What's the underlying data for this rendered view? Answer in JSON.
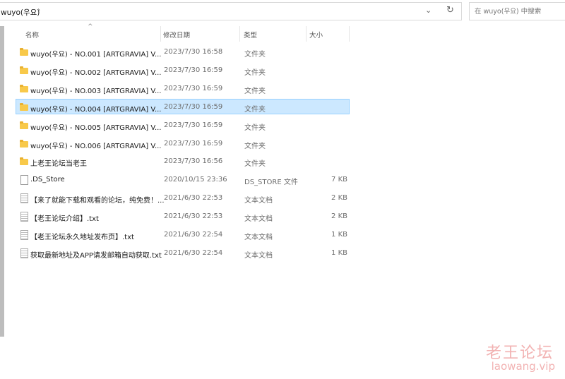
{
  "address": {
    "path": "wuyo(우요)",
    "separator": "›",
    "dropdown_icon": "chevron-down",
    "refresh_icon": "refresh"
  },
  "search": {
    "placeholder": "在 wuyo(우요) 中搜索"
  },
  "columns": {
    "name": "名称",
    "date": "修改日期",
    "type": "类型",
    "size": "大小"
  },
  "rows": [
    {
      "name": "wuyo(우요) - NO.001 [ARTGRAVIA] V...",
      "date": "2023/7/30 16:58",
      "type": "文件夹",
      "size": "",
      "icon": "folder"
    },
    {
      "name": "wuyo(우요) - NO.002 [ARTGRAVIA] V...",
      "date": "2023/7/30 16:59",
      "type": "文件夹",
      "size": "",
      "icon": "folder"
    },
    {
      "name": "wuyo(우요) - NO.003 [ARTGRAVIA] V...",
      "date": "2023/7/30 16:59",
      "type": "文件夹",
      "size": "",
      "icon": "folder"
    },
    {
      "name": "wuyo(우요) - NO.004 [ARTGRAVIA] V...",
      "date": "2023/7/30 16:59",
      "type": "文件夹",
      "size": "",
      "icon": "folder",
      "selected": true
    },
    {
      "name": "wuyo(우요) - NO.005 [ARTGRAVIA] V...",
      "date": "2023/7/30 16:59",
      "type": "文件夹",
      "size": "",
      "icon": "folder"
    },
    {
      "name": "wuyo(우요) - NO.006 [ARTGRAVIA] V...",
      "date": "2023/7/30 16:59",
      "type": "文件夹",
      "size": "",
      "icon": "folder"
    },
    {
      "name": "上老王论坛当老王",
      "date": "2023/7/30 16:56",
      "type": "文件夹",
      "size": "",
      "icon": "folder"
    },
    {
      "name": ".DS_Store",
      "date": "2020/10/15 23:36",
      "type": "DS_STORE 文件",
      "size": "7 KB",
      "icon": "file"
    },
    {
      "name": "【来了就能下载和观看的论坛，纯免费！...",
      "date": "2021/6/30 22:53",
      "type": "文本文档",
      "size": "2 KB",
      "icon": "txt"
    },
    {
      "name": "【老王论坛介绍】.txt",
      "date": "2021/6/30 22:53",
      "type": "文本文档",
      "size": "2 KB",
      "icon": "txt"
    },
    {
      "name": "【老王论坛永久地址发布页】.txt",
      "date": "2021/6/30 22:54",
      "type": "文本文档",
      "size": "1 KB",
      "icon": "txt"
    },
    {
      "name": "获取最新地址及APP请发邮箱自动获取.txt",
      "date": "2021/6/30 22:54",
      "type": "文本文档",
      "size": "1 KB",
      "icon": "txt"
    }
  ],
  "watermark": {
    "line1": "老王论坛",
    "line2": "laowang.vip"
  }
}
